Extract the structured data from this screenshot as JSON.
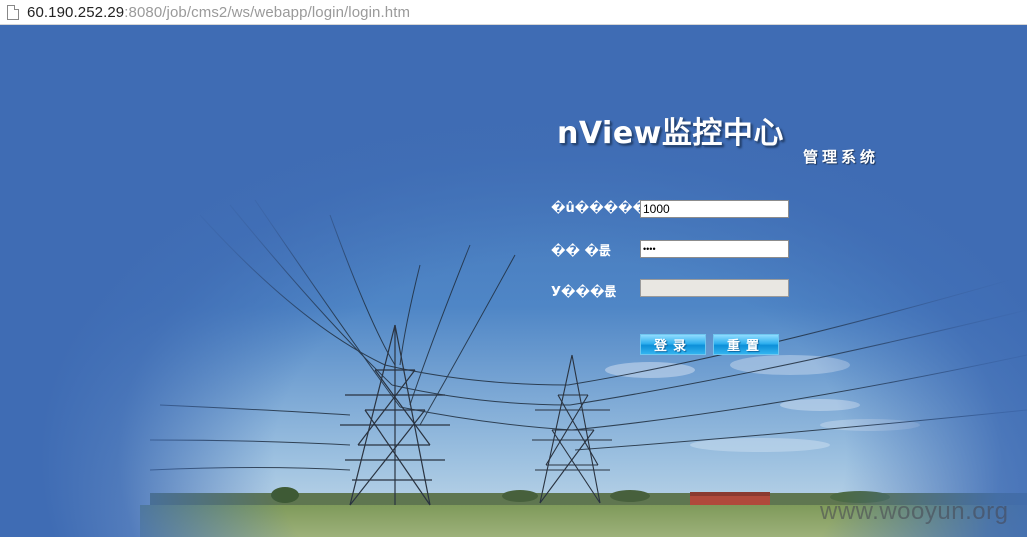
{
  "address_bar": {
    "host": "60.190.252.29",
    "path": ":8080/job/cms2/ws/webapp/login/login.htm"
  },
  "header": {
    "title": "nView监控中心",
    "subtitle": "管理系统"
  },
  "login_form": {
    "username_label": "�û�����",
    "username_value": "1000",
    "password_label": "��  �룺",
    "password_value": "••••",
    "captcha_label": "У���룺",
    "captcha_value": "",
    "login_button": "登录",
    "reset_button": "重置"
  },
  "watermark": "www.wooyun.org",
  "colors": {
    "background": "#3f6cb4",
    "button": "#2fb0ef",
    "disabled_field": "#e9e7e2"
  }
}
